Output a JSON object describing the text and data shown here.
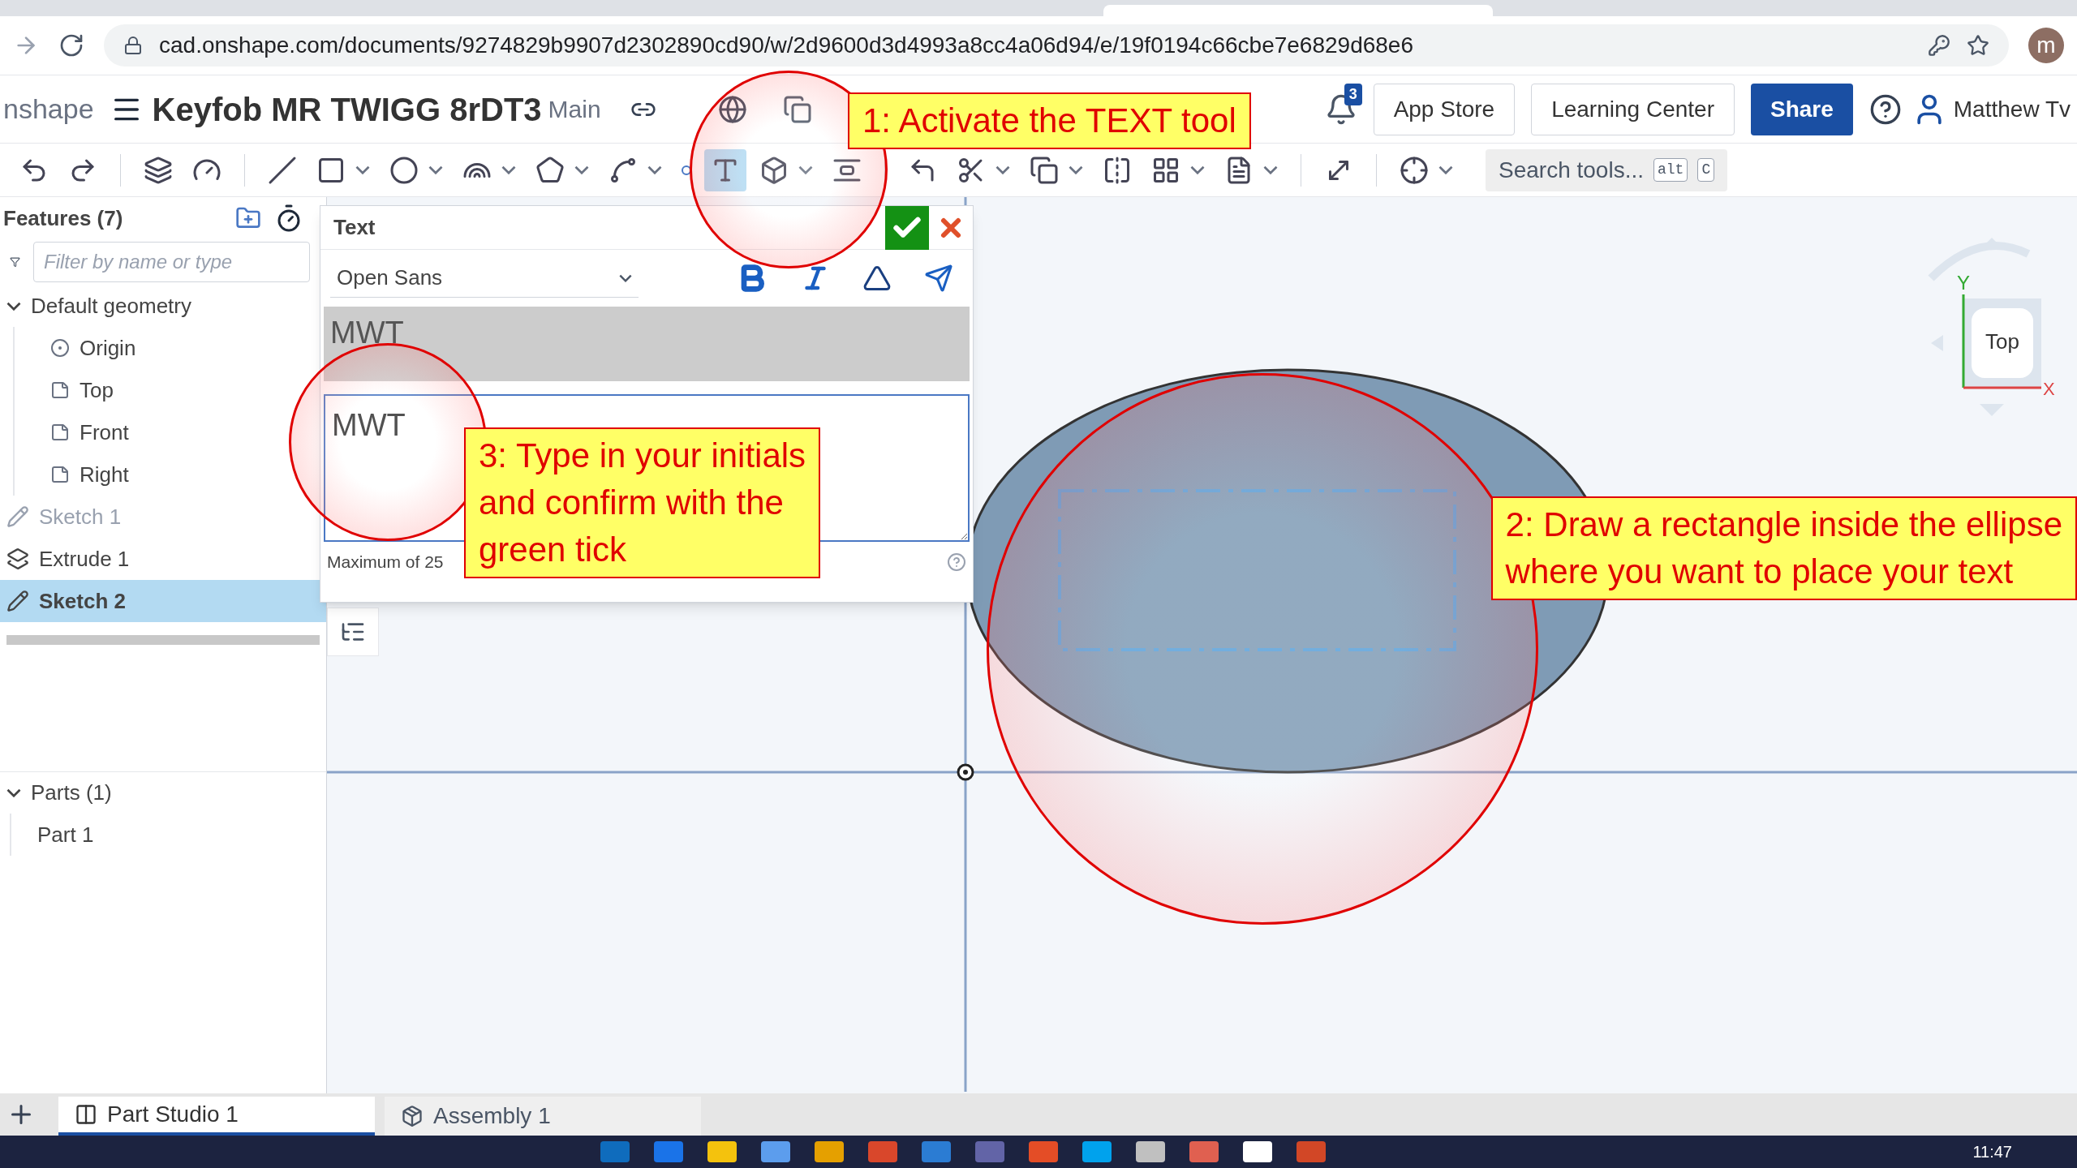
{
  "browser": {
    "url": "cad.onshape.com/documents/9274829b9907d2302890cd90/w/2d9600d3d4993a8cc4a06d94/e/19f0194c66cbe7e6829d68e6",
    "avatar_letter": "m"
  },
  "header": {
    "logo_text": "nshape",
    "document_title": "Keyfob MR TWIGG 8rDT3",
    "branch": "Main",
    "notification_count": "3",
    "buttons": [
      "App Store",
      "Learning Center"
    ],
    "share": "Share",
    "user": "Matthew Tv"
  },
  "toolbar": {
    "groups": [
      [
        {
          "kind": "undo",
          "selected": false,
          "dropdown": false
        },
        {
          "kind": "redo",
          "selected": false,
          "dropdown": false
        }
      ],
      [
        {
          "kind": "sketch",
          "selected": false,
          "dropdown": false
        },
        {
          "kind": "variable",
          "selected": false,
          "dropdown": false
        }
      ],
      [
        {
          "kind": "line",
          "selected": false,
          "dropdown": false
        },
        {
          "kind": "rectangle",
          "selected": false,
          "dropdown": true
        },
        {
          "kind": "ellipse",
          "selected": false,
          "dropdown": true
        },
        {
          "kind": "arc",
          "selected": false,
          "dropdown": true
        },
        {
          "kind": "polygon",
          "selected": false,
          "dropdown": true
        },
        {
          "kind": "spline",
          "selected": false,
          "dropdown": true
        },
        {
          "kind": "point",
          "selected": false,
          "dropdown": false
        },
        {
          "kind": "text",
          "selected": true,
          "dropdown": false
        },
        {
          "kind": "box",
          "selected": false,
          "dropdown": true
        },
        {
          "kind": "align",
          "selected": false,
          "dropdown": false
        }
      ],
      [
        {
          "kind": "fillet",
          "selected": false,
          "dropdown": false
        },
        {
          "kind": "trim",
          "selected": false,
          "dropdown": true
        },
        {
          "kind": "offset",
          "selected": false,
          "dropdown": true
        },
        {
          "kind": "mirror",
          "selected": false,
          "dropdown": false
        },
        {
          "kind": "pattern",
          "selected": false,
          "dropdown": true
        },
        {
          "kind": "dxf",
          "selected": false,
          "dropdown": true
        }
      ],
      [
        {
          "kind": "transform",
          "selected": false,
          "dropdown": false
        }
      ],
      [
        {
          "kind": "constraint",
          "selected": false,
          "dropdown": true
        }
      ]
    ],
    "search_placeholder": "Search tools...",
    "shortcut_keys": [
      "alt",
      "C"
    ]
  },
  "features": {
    "title": "Features (7)",
    "filter_placeholder": "Filter by name or type",
    "tree": [
      {
        "label": "Default geometry",
        "kind": "group",
        "expanded": true,
        "selected": false,
        "dimmed": false,
        "children": [
          {
            "label": "Origin",
            "kind": "point"
          },
          {
            "label": "Top",
            "kind": "plane"
          },
          {
            "label": "Front",
            "kind": "plane"
          },
          {
            "label": "Right",
            "kind": "plane"
          }
        ]
      },
      {
        "label": "Sketch 1",
        "kind": "sketch",
        "selected": false,
        "dimmed": true
      },
      {
        "label": "Extrude 1",
        "kind": "extrude",
        "selected": false,
        "dimmed": false
      },
      {
        "label": "Sketch 2",
        "kind": "sketch",
        "selected": true,
        "dimmed": false
      }
    ],
    "parts": {
      "label": "Parts (1)",
      "expanded": true,
      "children": [
        {
          "label": "Part 1"
        }
      ]
    }
  },
  "text_dialog": {
    "title": "Text",
    "font": "Open Sans",
    "preview": "MWT",
    "value": "MWT",
    "hint": "Maximum of 25"
  },
  "viewport": {
    "view_cube": {
      "face": "Top",
      "x_axis": "X",
      "y_axis": "Y"
    }
  },
  "bottom_tabs": [
    {
      "label": "Part Studio 1",
      "kind": "studio",
      "selected": true
    },
    {
      "label": "Assembly 1",
      "kind": "assembly",
      "selected": false
    }
  ],
  "taskbar": {
    "time": "11:47"
  },
  "annotations": [
    {
      "lines": [
        "1: Activate the TEXT tool"
      ]
    },
    {
      "lines": [
        "2: Draw a rectangle inside the ellipse",
        "where you want to place your text"
      ]
    },
    {
      "lines": [
        "3: Type in your initials",
        "and confirm with the",
        "green tick"
      ]
    }
  ]
}
